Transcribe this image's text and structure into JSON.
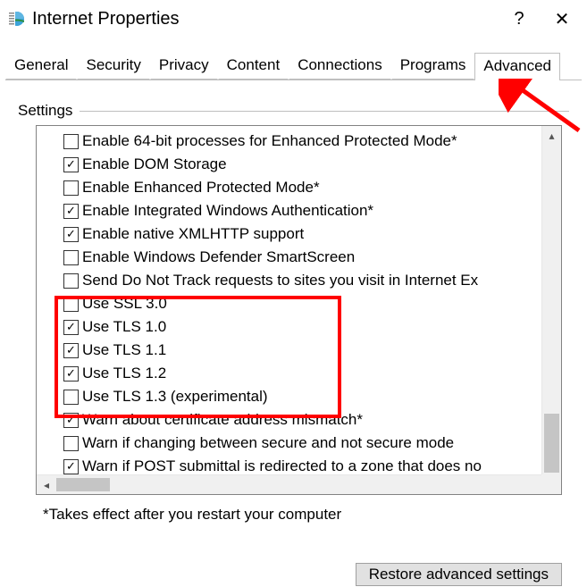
{
  "window": {
    "title": "Internet Properties",
    "help_char": "?",
    "close_char": "✕"
  },
  "tabs": {
    "items": [
      "General",
      "Security",
      "Privacy",
      "Content",
      "Connections",
      "Programs",
      "Advanced"
    ],
    "active_index": 6
  },
  "settings": {
    "label": "Settings",
    "items": [
      {
        "label": "Enable 64-bit processes for Enhanced Protected Mode*",
        "checked": false
      },
      {
        "label": "Enable DOM Storage",
        "checked": true
      },
      {
        "label": "Enable Enhanced Protected Mode*",
        "checked": false
      },
      {
        "label": "Enable Integrated Windows Authentication*",
        "checked": true
      },
      {
        "label": "Enable native XMLHTTP support",
        "checked": true
      },
      {
        "label": "Enable Windows Defender SmartScreen",
        "checked": false
      },
      {
        "label": "Send Do Not Track requests to sites you visit in Internet Ex",
        "checked": false
      },
      {
        "label": "Use SSL 3.0",
        "checked": false
      },
      {
        "label": "Use TLS 1.0",
        "checked": true
      },
      {
        "label": "Use TLS 1.1",
        "checked": true
      },
      {
        "label": "Use TLS 1.2",
        "checked": true
      },
      {
        "label": "Use TLS 1.3 (experimental)",
        "checked": false
      },
      {
        "label": "Warn about certificate address mismatch*",
        "checked": true
      },
      {
        "label": "Warn if changing between secure and not secure mode",
        "checked": false
      },
      {
        "label": "Warn if POST submittal is redirected to a zone that does no",
        "checked": true
      }
    ]
  },
  "footnote": "*Takes effect after you restart your computer",
  "restore_label": "Restore advanced settings",
  "annotation": {
    "highlight_start_index": 7,
    "highlight_end_index": 11
  }
}
